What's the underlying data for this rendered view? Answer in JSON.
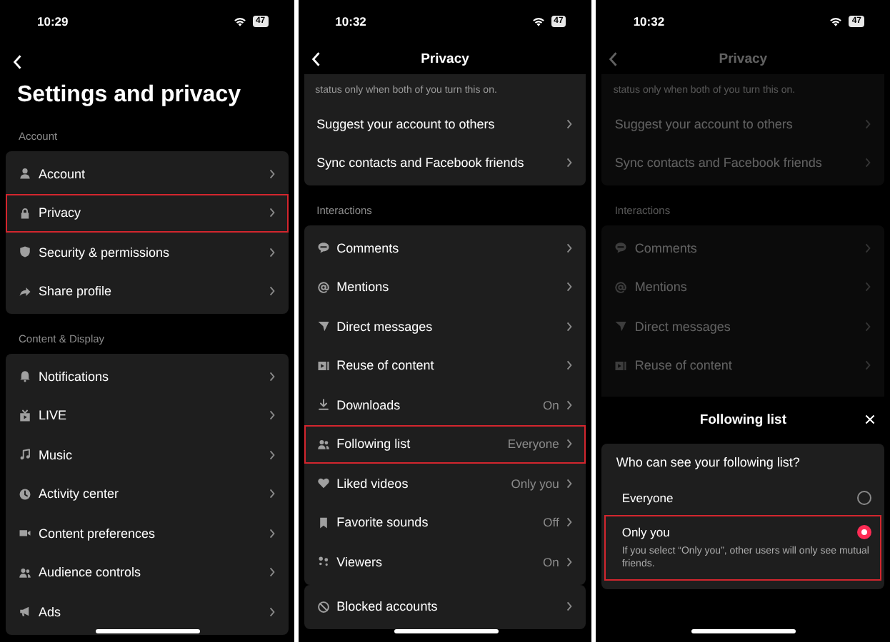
{
  "settings_screen": {
    "status": {
      "time": "10:29",
      "battery": "47"
    },
    "title": "Settings and privacy",
    "sections": [
      {
        "label": "Account",
        "rows": [
          {
            "label": "Account",
            "highlighted": false
          },
          {
            "label": "Privacy",
            "highlighted": true
          },
          {
            "label": "Security & permissions",
            "highlighted": false
          },
          {
            "label": "Share profile",
            "highlighted": false
          }
        ]
      },
      {
        "label": "Content & Display",
        "rows": [
          {
            "label": "Notifications",
            "highlighted": false
          },
          {
            "label": "LIVE",
            "highlighted": false
          },
          {
            "label": "Music",
            "highlighted": false
          },
          {
            "label": "Activity center",
            "highlighted": false
          },
          {
            "label": "Content preferences",
            "highlighted": false
          },
          {
            "label": "Audience controls",
            "highlighted": false
          },
          {
            "label": "Ads",
            "highlighted": false
          }
        ]
      }
    ]
  },
  "privacy_screen": {
    "status": {
      "time": "10:32",
      "battery": "47"
    },
    "title": "Privacy",
    "sections": [
      {
        "note": "status only when both of you turn this on.",
        "rows": [
          {
            "label": "Suggest your account to others",
            "highlighted": false
          },
          {
            "label": "Sync contacts and Facebook friends",
            "highlighted": false
          }
        ]
      },
      {
        "label": "Interactions",
        "rows": [
          {
            "label": "Comments",
            "highlighted": false
          },
          {
            "label": "Mentions",
            "highlighted": false
          },
          {
            "label": "Direct messages",
            "highlighted": false
          },
          {
            "label": "Reuse of content",
            "highlighted": false
          },
          {
            "label": "Downloads",
            "value": "On",
            "highlighted": false
          },
          {
            "label": "Following list",
            "value": "Everyone",
            "highlighted": true
          },
          {
            "label": "Liked videos",
            "value": "Only you",
            "highlighted": false
          },
          {
            "label": "Favorite sounds",
            "value": "Off",
            "highlighted": false
          },
          {
            "label": "Viewers",
            "value": "On",
            "highlighted": false
          }
        ]
      },
      {
        "rows": [
          {
            "label": "Blocked accounts",
            "highlighted": false
          }
        ]
      }
    ]
  },
  "following_list_screen": {
    "status": {
      "time": "10:32",
      "battery": "47"
    },
    "background": {
      "title": "Privacy",
      "sections": [
        {
          "note": "status only when both of you turn this on.",
          "rows": [
            {
              "label": "Suggest your account to others",
              "highlighted": false
            },
            {
              "label": "Sync contacts and Facebook friends",
              "highlighted": false
            }
          ]
        },
        {
          "label": "Interactions",
          "rows": [
            {
              "label": "Comments",
              "highlighted": false
            },
            {
              "label": "Mentions",
              "highlighted": false
            },
            {
              "label": "Direct messages",
              "highlighted": false
            },
            {
              "label": "Reuse of content",
              "highlighted": false
            }
          ]
        }
      ]
    },
    "sheet": {
      "title": "Following list",
      "question": "Who can see your following list?",
      "options": [
        {
          "label": "Everyone",
          "selected": false,
          "highlighted": false
        },
        {
          "label": "Only you",
          "description": "If you select “Only you”, other users will only see mutual friends.",
          "selected": true,
          "highlighted": true
        }
      ]
    }
  }
}
